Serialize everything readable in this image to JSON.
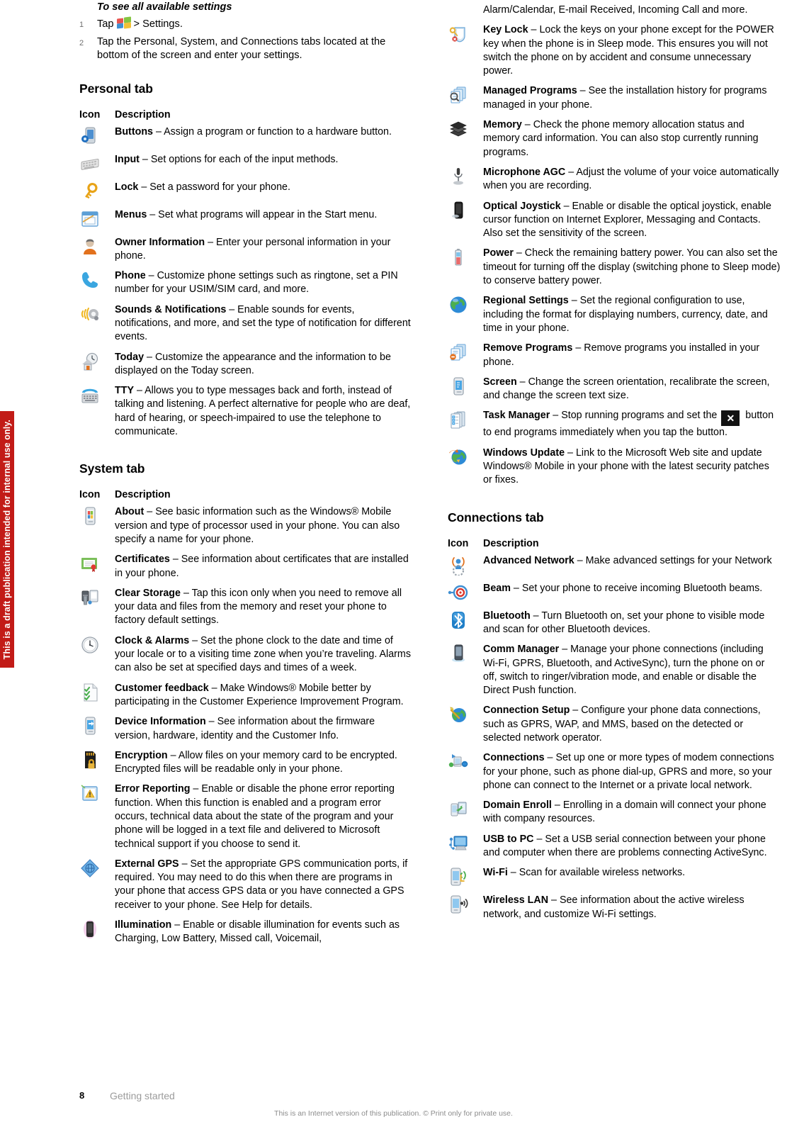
{
  "watermark": {
    "side_text": "This is a draft publication intended for internal use only.",
    "color": "#c21b17"
  },
  "intro": {
    "title": "To see all available settings",
    "steps": [
      {
        "num": "1",
        "before": "Tap",
        "icon": "windows-start-logo",
        "after": "> Settings."
      },
      {
        "num": "2",
        "text": "Tap the Personal, System, and Connections tabs located at the bottom of the screen and enter your settings."
      }
    ]
  },
  "tables": {
    "personal": {
      "heading": "Personal tab",
      "columns": {
        "icon": "Icon",
        "description": "Description"
      },
      "rows": [
        {
          "icon": "buttons-icon",
          "term": "Buttons",
          "text": " – Assign a program or function to a hardware button."
        },
        {
          "icon": "input-keyboard-icon",
          "term": "Input",
          "text": " – Set options for each of the input methods."
        },
        {
          "icon": "lock-key-icon",
          "term": "Lock",
          "text": " – Set a password for your phone."
        },
        {
          "icon": "menus-icon",
          "term": "Menus",
          "text": " – Set what programs will appear in the Start menu."
        },
        {
          "icon": "owner-info-icon",
          "term": "Owner Information",
          "text": " – Enter your personal information in your phone."
        },
        {
          "icon": "phone-icon",
          "term": "Phone",
          "text": " – Customize phone settings such as ringtone, set a PIN number for your USIM/SIM card, and more."
        },
        {
          "icon": "sounds-icon",
          "term": "Sounds & Notifications",
          "text": " – Enable sounds for events, notifications, and more, and set the type of notification for different events."
        },
        {
          "icon": "today-icon",
          "term": "Today",
          "text": " – Customize the appearance and the information to be displayed on the Today screen."
        },
        {
          "icon": "tty-icon",
          "term": "TTY",
          "text": " – Allows you to type messages back and forth, instead of talking and listening. A perfect alternative for people who are deaf, hard of hearing, or speech-impaired to use the telephone to communicate."
        }
      ]
    },
    "system": {
      "heading": "System tab",
      "columns": {
        "icon": "Icon",
        "description": "Description"
      },
      "rows_left": [
        {
          "icon": "about-icon",
          "term": "About",
          "text": " – See basic information such as the Windows® Mobile version and type of processor used in your phone. You can also specify a name for your phone."
        },
        {
          "icon": "certificates-icon",
          "term": "Certificates",
          "text": " – See information about certificates that are installed in your phone."
        },
        {
          "icon": "clear-storage-icon",
          "term": "Clear Storage",
          "text": " – Tap this icon only when you need to remove all your data and files from the memory and reset your phone to factory default settings."
        },
        {
          "icon": "clock-alarms-icon",
          "term": "Clock & Alarms",
          "text": " – Set the phone clock to the date and time of your locale or to a visiting time zone when you’re traveling. Alarms can also be set at specified days and times of a week."
        },
        {
          "icon": "customer-feedback-icon",
          "term": "Customer feedback",
          "text": " – Make Windows® Mobile better by participating in the Customer Experience Improvement Program."
        },
        {
          "icon": "device-info-icon",
          "term": "Device Information",
          "text": " – See information about the firmware version, hardware, identity and the Customer Info."
        },
        {
          "icon": "encryption-icon",
          "term": "Encryption",
          "text": " – Allow files on your memory card to be encrypted. Encrypted files will be readable only in your phone."
        },
        {
          "icon": "error-reporting-icon",
          "term": "Error Reporting",
          "text": " – Enable or disable the phone error reporting function. When this function is enabled and a program error occurs, technical data about the state of the program and your phone will be logged in a text file and delivered to Microsoft technical support if you choose to send it."
        },
        {
          "icon": "external-gps-icon",
          "term": "External GPS",
          "text": " – Set the appropriate GPS communication ports, if required. You may need to do this when there are programs in your phone that access GPS data or you have connected a GPS receiver to your phone. See Help for details."
        },
        {
          "icon": "illumination-icon",
          "term": "Illumination",
          "text": " – Enable or disable illumination for events such as Charging, Low Battery, Missed call, Voicemail,"
        }
      ],
      "continuation": "Alarm/Calendar, E-mail Received, Incoming Call and more.",
      "rows_right": [
        {
          "icon": "key-lock-icon",
          "term": "Key Lock",
          "text": " – Lock the keys on your phone except for the POWER key when the phone is in Sleep mode. This ensures you will not switch the phone on by accident and consume unnecessary power."
        },
        {
          "icon": "managed-programs-icon",
          "term": "Managed Programs",
          "text": " – See the installation history for programs managed in your phone."
        },
        {
          "icon": "memory-icon",
          "term": "Memory",
          "text": " – Check the phone memory allocation status and memory card information. You can also stop currently running programs."
        },
        {
          "icon": "microphone-agc-icon",
          "term": "Microphone AGC",
          "text": " – Adjust the volume of your voice automatically when you are recording."
        },
        {
          "icon": "optical-joystick-icon",
          "term": "Optical Joystick",
          "text": " – Enable or disable the optical joystick, enable cursor function on Internet Explorer, Messaging and Contacts. Also set the sensitivity of the screen."
        },
        {
          "icon": "power-icon",
          "term": "Power",
          "text": " – Check the remaining battery power. You can also set the timeout for turning off the display (switching phone to Sleep mode) to conserve battery power."
        },
        {
          "icon": "regional-settings-icon",
          "term": "Regional Settings",
          "text": " – Set the regional configuration to use, including the format for displaying numbers, currency, date, and time in your phone."
        },
        {
          "icon": "remove-programs-icon",
          "term": "Remove Programs",
          "text": " – Remove programs you installed in your phone."
        },
        {
          "icon": "screen-icon",
          "term": "Screen",
          "text": " – Change the screen orientation, recalibrate the screen, and change the screen text size."
        },
        {
          "icon": "task-manager-icon",
          "term": "Task Manager",
          "text": " – Stop running programs and set the ",
          "inline_button": "x-button",
          "text2": " button to end programs immediately when you tap the button."
        },
        {
          "icon": "windows-update-icon",
          "term": "Windows Update",
          "text": " – Link to the Microsoft Web site and update Windows® Mobile in your phone with the latest security patches or fixes."
        }
      ]
    },
    "connections": {
      "heading": "Connections tab",
      "columns": {
        "icon": "Icon",
        "description": "Description"
      },
      "rows": [
        {
          "icon": "advanced-network-icon",
          "term": "Advanced Network",
          "text": " – Make advanced settings for your Network"
        },
        {
          "icon": "beam-icon",
          "term": "Beam",
          "text": " – Set your phone to receive incoming Bluetooth beams."
        },
        {
          "icon": "bluetooth-icon",
          "term": "Bluetooth",
          "text": " – Turn Bluetooth on, set your phone to visible mode and scan for other Bluetooth devices."
        },
        {
          "icon": "comm-manager-icon",
          "term": "Comm Manager",
          "text": " – Manage your phone connections (including Wi-Fi, GPRS, Bluetooth, and ActiveSync), turn the phone on or off, switch to ringer/vibration mode, and enable or disable the Direct Push function."
        },
        {
          "icon": "connection-setup-icon",
          "term": "Connection Setup",
          "text": " – Configure your phone data connections, such as GPRS, WAP, and MMS, based on the detected or selected network operator."
        },
        {
          "icon": "connections-icon",
          "term": "Connections",
          "text": " – Set up one or more types of modem connections for your phone, such as phone dial-up, GPRS and more, so your phone can connect to the Internet or a private local network."
        },
        {
          "icon": "domain-enroll-icon",
          "term": "Domain Enroll",
          "text": " – Enrolling in a domain will connect your phone with company resources."
        },
        {
          "icon": "usb-to-pc-icon",
          "term": "USB to PC",
          "text": " – Set a USB serial connection between your phone and computer when there are problems connecting ActiveSync."
        },
        {
          "icon": "wifi-icon",
          "term": "Wi-Fi",
          "text": " – Scan for available wireless networks."
        },
        {
          "icon": "wireless-lan-icon",
          "term": "Wireless LAN",
          "text": " – See information about the active wireless network, and customize Wi-Fi settings."
        }
      ]
    }
  },
  "footer": {
    "page_number": "8",
    "chapter": "Getting started",
    "note": "This is an Internet version of this publication. © Print only for private use."
  }
}
